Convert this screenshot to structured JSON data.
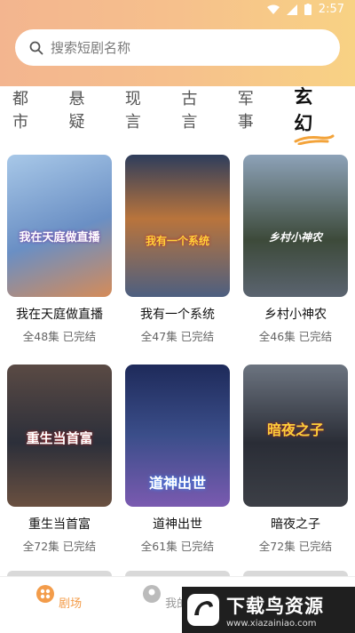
{
  "status_bar": {
    "time": "2:57"
  },
  "search": {
    "placeholder": "搜索短剧名称"
  },
  "tabs": [
    {
      "label": "都市",
      "active": false
    },
    {
      "label": "悬疑",
      "active": false
    },
    {
      "label": "现言",
      "active": false
    },
    {
      "label": "古言",
      "active": false
    },
    {
      "label": "军事",
      "active": false
    },
    {
      "label": "玄幻",
      "active": true
    }
  ],
  "dramas": [
    {
      "name": "我在天庭做直播",
      "meta": "全48集 已完结",
      "poster_text": "我在天庭做直播",
      "poster_color": "#6a8fc4"
    },
    {
      "name": "我有一个系统",
      "meta": "全47集 已完结",
      "poster_text": "我有一个系统",
      "poster_color": "#4d5f80"
    },
    {
      "name": "乡村小神农",
      "meta": "全46集 已完结",
      "poster_text": "乡村小神农",
      "poster_color": "#3d4a3a"
    },
    {
      "name": "重生当首富",
      "meta": "全72集 已完结",
      "poster_text": "重生当首富",
      "poster_color": "#2c2f3a"
    },
    {
      "name": "道神出世",
      "meta": "全61集 已完结",
      "poster_text": "道神出世",
      "poster_color": "#3b4e8a"
    },
    {
      "name": "暗夜之子",
      "meta": "全72集 已完结",
      "poster_text": "暗夜之子",
      "poster_color": "#2a2d36"
    }
  ],
  "bottom_nav": [
    {
      "label": "剧场",
      "icon": "theater-icon",
      "active": true
    },
    {
      "label": "我的",
      "icon": "profile-icon",
      "active": false
    }
  ],
  "watermark": {
    "title": "下载鸟资源",
    "url": "www.xiazainiao.com"
  },
  "colors": {
    "accent": "#f39c4a",
    "header_start": "#f3b58f",
    "header_end": "#f8d284"
  }
}
